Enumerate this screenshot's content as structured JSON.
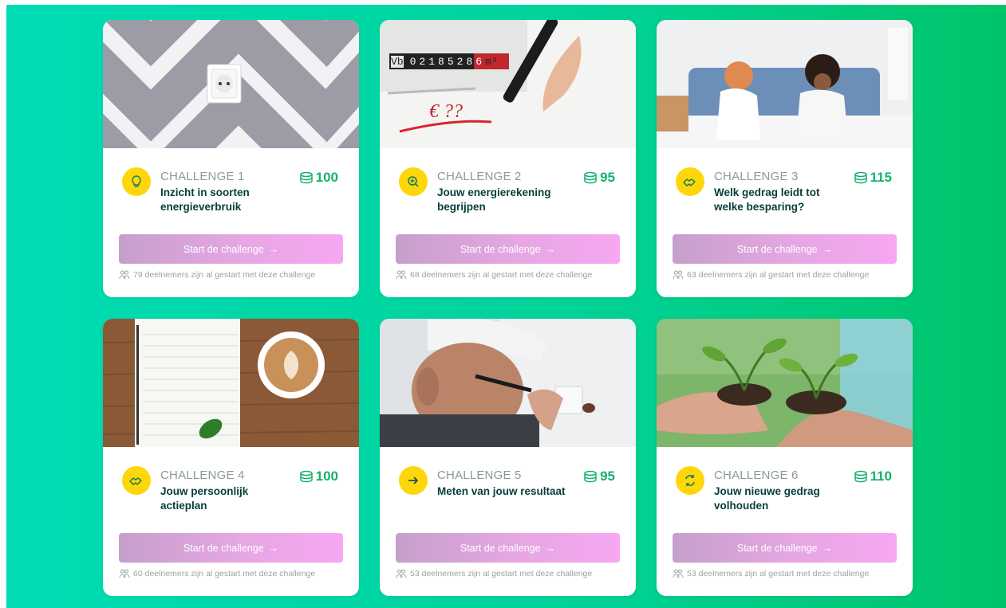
{
  "cards": [
    {
      "number": "CHALLENGE 1",
      "title": "Inzicht in soorten energieverbruik",
      "points": "100",
      "button": "Start de challenge",
      "arrow": "→",
      "participants_count": "79",
      "participants_text": "deelnemers zijn al gestart met deze challenge",
      "icon": "lightbulb-icon"
    },
    {
      "number": "CHALLENGE 2",
      "title": "Jouw energierekening begrijpen",
      "points": "95",
      "button": "Start de challenge",
      "arrow": "→",
      "participants_count": "68",
      "participants_text": "deelnemers zijn al gestart met deze challenge",
      "icon": "magnifier-plus-icon",
      "meter": {
        "label": "Vb",
        "digits": [
          "0",
          "2",
          "1",
          "8",
          "5",
          "2",
          "8",
          "6"
        ],
        "unit": "m³",
        "note": "€ ??"
      }
    },
    {
      "number": "CHALLENGE 3",
      "title": "Welk gedrag leidt tot welke besparing?",
      "points": "115",
      "button": "Start de challenge",
      "arrow": "→",
      "participants_count": "63",
      "participants_text": "deelnemers zijn al gestart met deze challenge",
      "icon": "handshake-icon"
    },
    {
      "number": "CHALLENGE 4",
      "title": "Jouw persoonlijk actieplan",
      "points": "100",
      "button": "Start de challenge",
      "arrow": "→",
      "participants_count": "60",
      "participants_text": "deelnemers zijn al gestart met deze challenge",
      "icon": "handshake-icon"
    },
    {
      "number": "CHALLENGE 5",
      "title": "Meten van jouw resultaat",
      "points": "95",
      "button": "Start de challenge",
      "arrow": "→",
      "participants_count": "53",
      "participants_text": "deelnemers zijn al gestart met deze challenge",
      "icon": "arrow-right-icon"
    },
    {
      "number": "CHALLENGE 6",
      "title": "Jouw nieuwe gedrag volhouden",
      "points": "110",
      "button": "Start de challenge",
      "arrow": "→",
      "participants_count": "53",
      "participants_text": "deelnemers zijn al gestart met deze challenge",
      "icon": "refresh-icon"
    }
  ],
  "colors": {
    "background_start": "#00dcb4",
    "background_end": "#00c46a",
    "badge": "#ffd60a",
    "points": "#14b26d",
    "title": "#06403a",
    "button_start": "#c69fcb",
    "button_end": "#f6a7f2"
  }
}
